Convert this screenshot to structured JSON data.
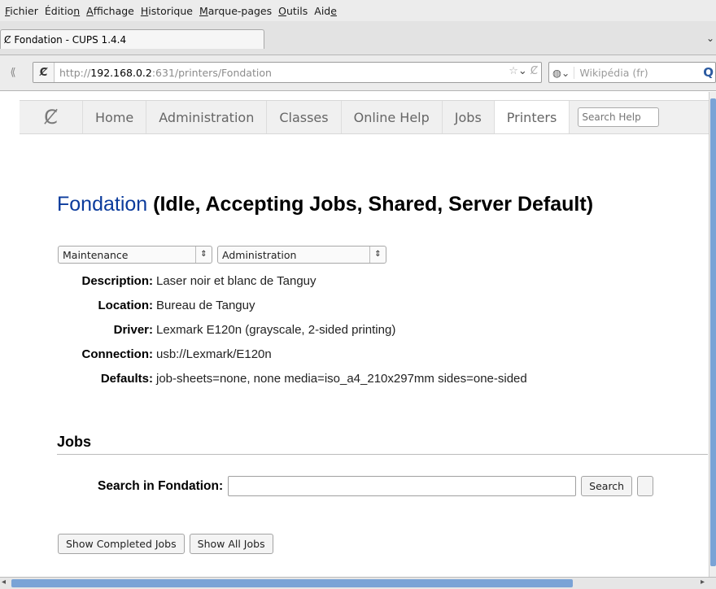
{
  "menubar": {
    "items": [
      {
        "pre": "",
        "u": "F",
        "post": "ichier"
      },
      {
        "pre": "Éditio",
        "u": "n",
        "post": ""
      },
      {
        "pre": "",
        "u": "A",
        "post": "ffichage"
      },
      {
        "pre": "",
        "u": "H",
        "post": "istorique"
      },
      {
        "pre": "",
        "u": "M",
        "post": "arque-pages"
      },
      {
        "pre": "",
        "u": "O",
        "post": "utils"
      },
      {
        "pre": "Aid",
        "u": "e",
        "post": ""
      }
    ]
  },
  "tab": {
    "title": "Fondation - CUPS 1.4.4",
    "scroll_glyph": "⌄"
  },
  "navbar": {
    "url_scheme": "http://",
    "url_host": "192.168.0.2",
    "url_rest": ":631/printers/Fondation",
    "search_placeholder": "Wikipédia (fr)"
  },
  "cups_nav": {
    "items": [
      "Home",
      "Administration",
      "Classes",
      "Online Help",
      "Jobs",
      "Printers"
    ],
    "active": "Printers",
    "search_placeholder": "Search Help"
  },
  "page": {
    "printer_name": "Fondation",
    "printer_status": " (Idle, Accepting Jobs, Shared, Server Default)",
    "maintenance_select": "Maintenance",
    "administration_select": "Administration",
    "info": {
      "description_label": "Description:",
      "description": "Laser noir et blanc de Tanguy",
      "location_label": "Location:",
      "location": "Bureau de Tanguy",
      "driver_label": "Driver:",
      "driver": "Lexmark E120n (grayscale, 2-sided printing)",
      "connection_label": "Connection:",
      "connection": "usb://Lexmark/E120n",
      "defaults_label": "Defaults:",
      "defaults": "job-sheets=none, none media=iso_a4_210x297mm sides=one-sided"
    },
    "jobs_heading": "Jobs",
    "search_label": "Search in Fondation:",
    "search_button": "Search",
    "show_completed": "Show Completed Jobs",
    "show_all": "Show All Jobs"
  }
}
